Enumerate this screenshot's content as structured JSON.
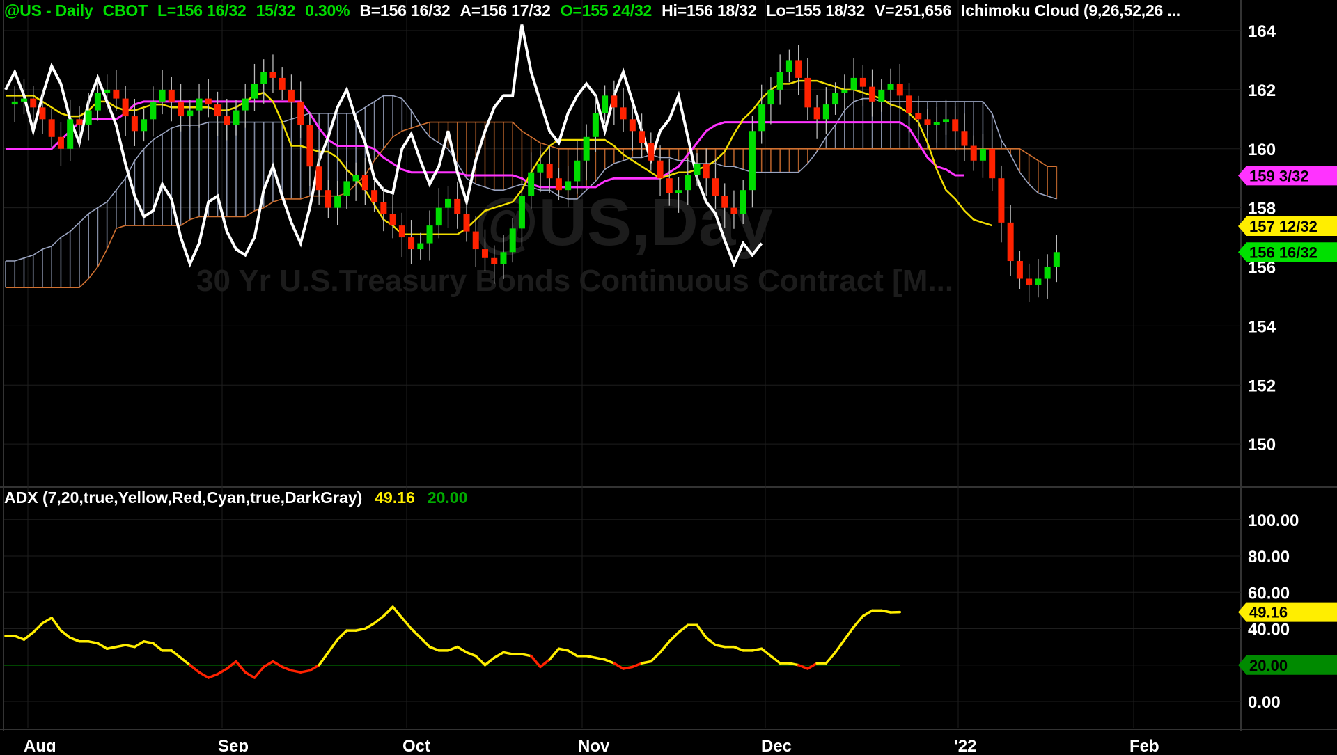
{
  "header": {
    "symbol": "@US - Daily",
    "exchange": "CBOT",
    "last": "L=156 16/32",
    "change": "15/32",
    "change_pct": "0.30%",
    "bid": "B=156 16/32",
    "ask": "A=156 17/32",
    "open": "O=155 24/32",
    "high": "Hi=156 18/32",
    "low": "Lo=155 18/32",
    "volume": "V=251,656",
    "indicator": "Ichimoku Cloud (9,26,52,26 ..."
  },
  "watermark": {
    "symbol": "@US,Day",
    "description": "30 Yr U.S.Treasury Bonds Continuous Contract [M..."
  },
  "adx_header": {
    "label": "ADX (7,20,true,Yellow,Red,Cyan,true,DarkGray)",
    "value": "49.16",
    "threshold": "20.00"
  },
  "price_labels": [
    {
      "text": "159 3/32",
      "value": 159.09,
      "color": "#ff33ff"
    },
    {
      "text": "157 12/32",
      "value": 157.38,
      "color": "#ffee00"
    },
    {
      "text": "156 16/32",
      "value": 156.5,
      "color": "#00e000"
    }
  ],
  "adx_labels": [
    {
      "text": "49.16",
      "value": 49.16,
      "color": "#ffee00"
    },
    {
      "text": "20.00",
      "value": 20.0,
      "color": "#008a00"
    }
  ],
  "colors": {
    "background": "#000000",
    "up_candle": "#00dd00",
    "down_candle": "#ff2200",
    "lagging_span": "#ffffff",
    "kijun": "#ff33ff",
    "tenkan": "#f0dc00",
    "cloud_bull": "#9aa4c0",
    "cloud_bear": "#d07030",
    "adx": "#ffee00",
    "adx_low": "#ff2200",
    "threshold": "#008a00",
    "grid": "#1e1e1e"
  },
  "chart_data": [
    {
      "type": "candlestick",
      "title": "@US - Daily",
      "x_ticks": [
        "Aug",
        "Sep",
        "Oct",
        "Nov",
        "Dec",
        "'22",
        "Feb"
      ],
      "y_ticks": [
        "164",
        "162",
        "160",
        "158",
        "156",
        "154",
        "152",
        "150"
      ],
      "ylim": [
        148.5,
        164.5
      ],
      "grid": true,
      "series": [
        {
          "name": "close",
          "values": [
            161.5,
            161.6,
            161.7,
            161.4,
            161.0,
            160.4,
            160.0,
            161.0,
            160.8,
            161.3,
            161.9,
            162.0,
            161.7,
            161.1,
            160.6,
            161.0,
            161.6,
            162.0,
            161.6,
            161.1,
            161.3,
            161.7,
            161.5,
            161.1,
            160.8,
            161.3,
            161.7,
            162.2,
            162.6,
            162.4,
            162.0,
            161.6,
            160.8,
            159.4,
            158.6,
            158.0,
            158.4,
            158.9,
            159.1,
            158.6,
            158.2,
            157.8,
            157.4,
            157.0,
            156.6,
            156.8,
            157.4,
            158.0,
            158.3,
            157.8,
            157.2,
            156.6,
            156.3,
            156.1,
            156.5,
            157.3,
            158.4,
            159.2,
            159.5,
            159.0,
            158.6,
            158.9,
            159.6,
            160.4,
            161.2,
            161.8,
            161.4,
            161.0,
            160.6,
            160.2,
            159.6,
            159.0,
            158.5,
            158.6,
            159.1,
            159.5,
            159.0,
            158.4,
            158.0,
            157.8,
            158.6,
            160.6,
            161.5,
            162.0,
            162.6,
            163.0,
            162.4,
            161.4,
            161.0,
            161.5,
            161.9,
            162.0,
            162.4,
            162.1,
            161.6,
            162.0,
            162.2,
            161.8,
            161.2,
            161.0,
            160.8,
            160.9,
            161.0,
            160.6,
            160.1,
            159.6,
            160.0,
            159.0,
            157.5,
            156.2,
            155.6,
            155.4,
            155.6,
            156.0,
            156.5
          ]
        },
        {
          "name": "tenkan",
          "values": [
            161.8,
            161.8,
            161.8,
            161.8,
            161.6,
            161.4,
            161.2,
            161.1,
            161.1,
            161.3,
            161.6,
            161.6,
            161.4,
            161.3,
            161.3,
            161.4,
            161.5,
            161.5,
            161.4,
            161.4,
            161.4,
            161.4,
            161.4,
            161.3,
            161.3,
            161.4,
            161.6,
            161.8,
            161.9,
            161.6,
            160.9,
            160.1,
            160.1,
            160.0,
            159.9,
            159.9,
            159.7,
            159.3,
            159.0,
            158.6,
            158.1,
            157.6,
            157.4,
            157.1,
            157.1,
            157.1,
            157.1,
            157.1,
            157.1,
            157.1,
            157.3,
            157.6,
            157.9,
            158.0,
            158.1,
            158.2,
            158.6,
            159.2,
            159.7,
            160.1,
            160.3,
            160.3,
            160.3,
            160.3,
            160.3,
            160.3,
            160.1,
            159.8,
            159.6,
            159.4,
            159.2,
            159.0,
            159.1,
            159.2,
            159.2,
            159.3,
            159.4,
            159.6,
            159.9,
            160.5,
            161.0,
            161.3,
            161.7,
            162.0,
            162.2,
            162.2,
            162.3,
            162.3,
            162.3,
            162.2,
            162.1,
            162.0,
            162.0,
            161.9,
            161.8,
            161.7,
            161.5,
            161.4,
            161.2,
            160.9,
            160.2,
            159.3,
            158.6,
            158.3,
            157.9,
            157.6,
            157.5,
            157.4
          ]
        },
        {
          "name": "kijun",
          "values": [
            160.0,
            160.0,
            160.0,
            160.0,
            160.0,
            160.0,
            160.3,
            160.6,
            160.9,
            161.0,
            161.0,
            161.0,
            161.0,
            161.2,
            161.5,
            161.6,
            161.6,
            161.6,
            161.6,
            161.6,
            161.6,
            161.6,
            161.6,
            161.6,
            161.6,
            161.6,
            161.6,
            161.6,
            161.6,
            161.6,
            161.6,
            161.6,
            161.6,
            161.2,
            160.7,
            160.3,
            160.1,
            160.1,
            160.1,
            160.1,
            160.0,
            159.7,
            159.5,
            159.3,
            159.2,
            159.2,
            159.2,
            159.2,
            159.2,
            159.2,
            159.1,
            159.1,
            159.1,
            159.1,
            159.1,
            159.1,
            159.0,
            158.8,
            158.7,
            158.7,
            158.7,
            158.7,
            158.7,
            158.7,
            158.7,
            158.9,
            159.0,
            159.0,
            159.0,
            159.0,
            159.0,
            159.0,
            159.2,
            159.4,
            159.8,
            160.2,
            160.6,
            160.8,
            160.9,
            160.9,
            160.9,
            160.9,
            160.9,
            160.9,
            160.9,
            160.9,
            160.9,
            160.9,
            160.9,
            160.9,
            160.9,
            160.9,
            160.9,
            160.9,
            160.9,
            160.9,
            160.9,
            160.9,
            160.7,
            160.2,
            159.7,
            159.4,
            159.3,
            159.1,
            159.1
          ]
        },
        {
          "name": "lagging_span",
          "values": [
            162.0,
            162.6,
            161.8,
            160.6,
            161.8,
            162.8,
            162.2,
            161.0,
            160.2,
            161.6,
            162.4,
            161.6,
            160.8,
            159.5,
            158.4,
            157.7,
            157.9,
            158.8,
            158.3,
            157.0,
            156.1,
            156.8,
            158.2,
            158.4,
            157.2,
            156.6,
            156.4,
            157.0,
            158.6,
            159.4,
            158.4,
            157.5,
            156.8,
            158.0,
            159.6,
            160.4,
            161.4,
            162.0,
            161.0,
            160.2,
            159.0,
            158.6,
            158.5,
            160.0,
            160.5,
            159.6,
            158.8,
            159.4,
            160.6,
            159.2,
            158.2,
            159.6,
            160.6,
            161.4,
            161.8,
            161.8,
            164.2,
            162.6,
            161.6,
            160.6,
            160.2,
            161.2,
            161.8,
            162.2,
            161.8,
            160.6,
            161.8,
            162.6,
            161.6,
            160.6,
            159.6,
            160.6,
            161.0,
            161.8,
            160.4,
            159.0,
            158.2,
            157.8,
            156.9,
            156.1,
            156.8,
            156.4,
            156.8
          ]
        },
        {
          "name": "senkou_a",
          "values": [
            156.2,
            156.2,
            156.3,
            156.4,
            156.6,
            156.7,
            157.0,
            157.2,
            157.5,
            157.8,
            158.0,
            158.2,
            158.6,
            159.0,
            159.6,
            160.0,
            160.3,
            160.5,
            160.7,
            160.8,
            160.8,
            160.8,
            160.9,
            160.9,
            160.9,
            160.9,
            160.9,
            160.9,
            160.9,
            160.9,
            160.9,
            161.0,
            161.1,
            161.2,
            161.2,
            161.2,
            161.2,
            161.2,
            161.2,
            161.4,
            161.6,
            161.8,
            161.8,
            161.7,
            161.3,
            160.8,
            160.4,
            160.2,
            160.0,
            159.5,
            159.0,
            158.8,
            158.7,
            158.6,
            158.6,
            158.7,
            158.8,
            158.7,
            158.6,
            158.6,
            158.4,
            158.3,
            158.3,
            158.6,
            158.9,
            159.3,
            159.5,
            159.6,
            159.7,
            159.7,
            159.8,
            159.7,
            159.7,
            159.6,
            159.6,
            159.5,
            159.5,
            159.5,
            159.4,
            159.4,
            159.3,
            159.2,
            159.2,
            159.2,
            159.2,
            159.2,
            159.2,
            159.5,
            159.9,
            160.4,
            160.8,
            161.3,
            161.6,
            161.7,
            161.7,
            161.6,
            161.6,
            161.6,
            161.6,
            161.6,
            161.6,
            161.6,
            161.6,
            161.6,
            161.6,
            161.6,
            161.6,
            161.2,
            160.3,
            159.8,
            159.2,
            158.8,
            158.5,
            158.4,
            158.3
          ]
        },
        {
          "name": "senkou_b",
          "values": [
            155.3,
            155.3,
            155.3,
            155.3,
            155.3,
            155.3,
            155.3,
            155.3,
            155.3,
            155.6,
            156.0,
            156.6,
            157.3,
            157.4,
            157.4,
            157.4,
            157.4,
            157.4,
            157.4,
            157.4,
            157.6,
            157.7,
            157.7,
            157.7,
            157.7,
            157.7,
            157.7,
            157.9,
            158.0,
            158.2,
            158.3,
            158.3,
            158.3,
            158.4,
            158.4,
            158.4,
            158.4,
            158.5,
            158.8,
            159.1,
            159.6,
            160.0,
            160.4,
            160.6,
            160.7,
            160.8,
            160.9,
            160.9,
            160.9,
            160.9,
            160.9,
            160.9,
            160.9,
            160.9,
            160.9,
            160.9,
            160.6,
            160.4,
            160.2,
            160.1,
            160.0,
            160.0,
            160.0,
            160.0,
            160.0,
            160.0,
            160.0,
            160.0,
            160.0,
            160.0,
            160.0,
            160.0,
            160.0,
            160.0,
            160.0,
            160.0,
            160.0,
            160.0,
            160.0,
            160.0,
            160.0,
            160.0,
            160.0,
            160.0,
            160.0,
            160.0,
            160.0,
            160.0,
            160.0,
            160.0,
            160.0,
            160.0,
            160.0,
            160.0,
            160.0,
            160.0,
            160.0,
            160.0,
            160.0,
            160.0,
            160.0,
            160.0,
            160.0,
            160.0,
            160.0,
            160.0,
            160.0,
            160.0,
            160.0,
            160.0,
            160.0,
            159.8,
            159.6,
            159.4,
            159.4
          ]
        }
      ]
    },
    {
      "type": "line",
      "title": "ADX (7,20,true,Yellow,Red,Cyan,true,DarkGray)",
      "x_ticks": [
        "Aug",
        "Sep",
        "Oct",
        "Nov",
        "Dec",
        "'22",
        "Feb"
      ],
      "y_ticks": [
        "100.00",
        "80.00",
        "60.00",
        "40.00",
        "20.00",
        "0.00"
      ],
      "ylim": [
        -10,
        110
      ],
      "grid": true,
      "threshold": 20,
      "series": [
        {
          "name": "ADX",
          "values": [
            36,
            36,
            34,
            38,
            43,
            46,
            39,
            35,
            33,
            33,
            32,
            29,
            30,
            31,
            30,
            33,
            32,
            28,
            28,
            24,
            20,
            16,
            13,
            15,
            18,
            22,
            16,
            13,
            19,
            22,
            19,
            17,
            16,
            17,
            20,
            27,
            34,
            39,
            39,
            40,
            43,
            47,
            52,
            46,
            40,
            35,
            30,
            28,
            28,
            30,
            27,
            25,
            20,
            24,
            27,
            26,
            26,
            25,
            19,
            23,
            29,
            28,
            25,
            25,
            24,
            23,
            21,
            18,
            19,
            21,
            22,
            27,
            33,
            38,
            42,
            42,
            35,
            31,
            30,
            30,
            28,
            28,
            29,
            25,
            21,
            21,
            20,
            18,
            21,
            21,
            27,
            34,
            41,
            47,
            50,
            50,
            49,
            49.16
          ]
        }
      ]
    }
  ]
}
